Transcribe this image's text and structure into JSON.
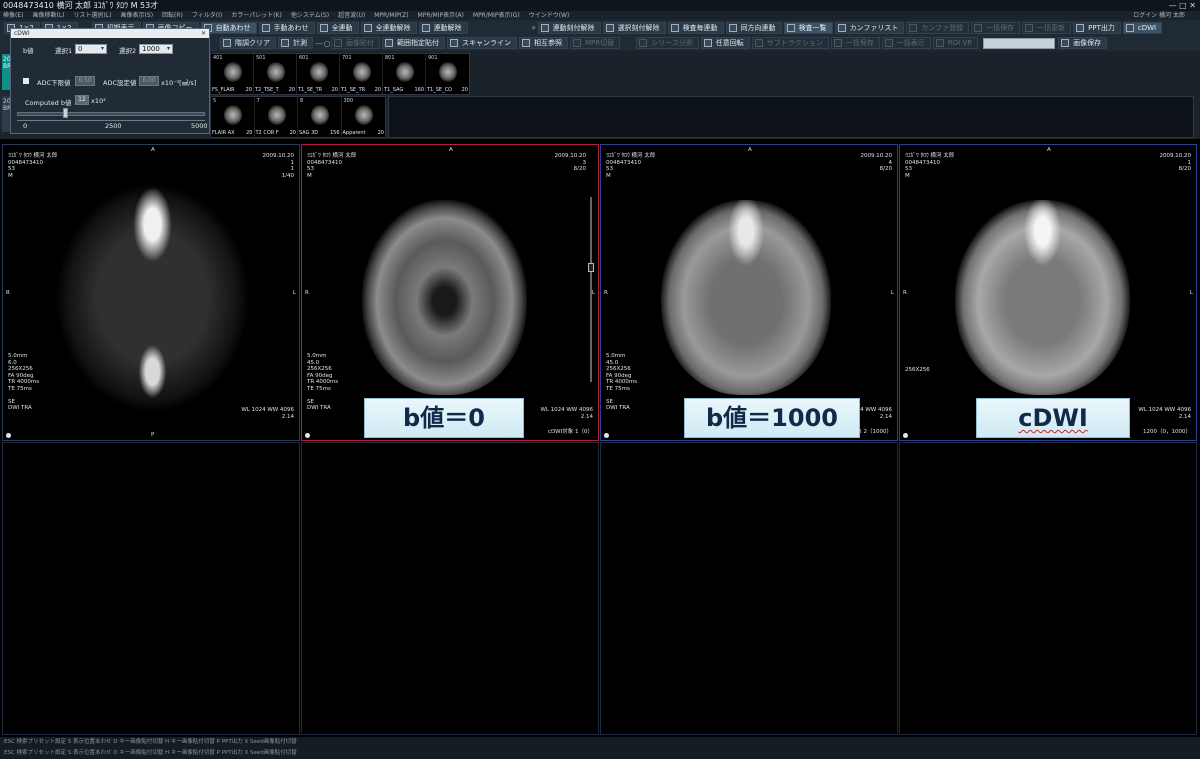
{
  "window": {
    "title": "0048473410 横河 太郎 ﾖｺｶﾞﾜ ﾀﾛｳ M 53才",
    "controls": "— □ ✕"
  },
  "menu": {
    "items": [
      "検像(E)",
      "画像移動(L)",
      "リスト選択(L)",
      "画像表示(S)",
      "回転(R)",
      "フィルタ(I)",
      "カラーパレット(K)",
      "他システム(S)",
      "超音波(U)",
      "MPR/MIP(Z)",
      "MPR/MIP表示(A)",
      "MPR/MIP表示(G)",
      "ウインドウ(W)"
    ],
    "login": "ログイン 横河 太郎"
  },
  "toolbar1": {
    "first": "1×2",
    "second": "1×2",
    "buttons": [
      "初期表示",
      "画像コピー",
      "自動あわせ",
      "手動あわせ",
      "全連動",
      "全連動解除",
      "連動解除"
    ],
    "right_buttons": [
      "連動刻付解除",
      "選択刻付解除",
      "検査毎連動",
      "同方向連動",
      "検査一覧",
      "カンファリスト",
      "カンファ登録",
      "一括保存",
      "一括更新",
      "PPT出力",
      "cDWI"
    ]
  },
  "toolbar2": {
    "buttons": [
      "階調クリア",
      "計測",
      "画像貼付",
      "範囲指定貼付",
      "スキャンライン",
      "相互参照",
      "MPR切替"
    ],
    "right_buttons": [
      "シリーズ分割",
      "任意回転",
      "サブトラクション",
      "一括保存",
      "一括表示",
      "ROI VR",
      "画像保存"
    ]
  },
  "dialog": {
    "title": "cDWI",
    "close": "✕",
    "bval_label": "b値",
    "sel1_label": "選択1",
    "sel1_value": "0",
    "sel2_label": "選択2",
    "sel2_value": "1000",
    "adc_lower_label": "ADC下限値",
    "adc_lower_value": "0.50",
    "adc_set_label": "ADC設定値",
    "adc_set_value": "0.00",
    "adc_unit": "x10⁻³[㎟/s]",
    "computed_label": "Computed b値",
    "computed_value": "12",
    "computed_unit": "x10²",
    "scale_min": "0",
    "scale_mid": "2500",
    "scale_max": "5000"
  },
  "leftpanel": {
    "btn1": "20 BR",
    "btn2": "20 BR"
  },
  "thumbnails_row1": [
    {
      "num": "401",
      "label": "FS_FLAIR",
      "count": "20"
    },
    {
      "num": "501",
      "label": "T2_TSE_T",
      "count": "20"
    },
    {
      "num": "601",
      "label": "T1_SE_TR",
      "count": "20"
    },
    {
      "num": "701",
      "label": "T1_SE_TR",
      "count": "20"
    },
    {
      "num": "801",
      "label": "T1_SAG",
      "count": "160"
    },
    {
      "num": "901",
      "label": "T1_SE_CO",
      "count": "20"
    }
  ],
  "thumbnails_row2": [
    {
      "num": "5",
      "label": "FLAIR AX",
      "count": "20"
    },
    {
      "num": "7",
      "label": "T2 COR F",
      "count": "20"
    },
    {
      "num": "8",
      "label": "SAG 3D",
      "count": "156"
    },
    {
      "num": "300",
      "label": "Apparent",
      "count": "20"
    }
  ],
  "viewports": [
    {
      "anterior": "A",
      "posterior": "P",
      "left": "L",
      "right": "R",
      "tl": "ﾖｺｶﾞﾜ ﾀﾛｳ 横河 太郎\n0048473410\n53\nM",
      "tr": "2009.10.20\n1\n1\n1/40",
      "bl": "5.0mm\n6.0\n256X256\nFA 90deg\nTR 4000ms\nTE 75ms\n\nSE\nDWI TRA",
      "br": "WL 1024 WW 4096\n2.14",
      "wl": "1024",
      "ww": "4096"
    },
    {
      "anterior": "A",
      "left": "L",
      "right": "R",
      "tl": "ﾖｺｶﾞﾜ ﾀﾛｳ 横河 太郎\n0048473410\n53\nM",
      "tr": "2009.10.20\n3\n8/20",
      "bl": "5.0mm\n45.0\n256X256\nFA 90deg\nTR 4000ms\nTE 75ms\n\nSE\nDWI TRA",
      "br": "WL 1024 WW 4096\n2.14",
      "br2": "cDWI対象 1（0）",
      "label": "b値＝0"
    },
    {
      "anterior": "A",
      "left": "L",
      "right": "R",
      "tl": "ﾖｺｶﾞﾜ ﾀﾛｳ 横河 太郎\n0048473410\n53\nM",
      "tr": "2009.10.20\n4\n8/20",
      "bl": "5.0mm\n45.0\n256X256\nFA 90deg\nTR 4000ms\nTE 75ms\n\nSE\nDWI TRA",
      "br": "WL 1024 WW 4096\n2.14",
      "br2": "象 2（1000）",
      "label": "b値＝1000"
    },
    {
      "anterior": "A",
      "left": "L",
      "right": "R",
      "tl": "ﾖｺｶﾞﾜ ﾀﾛｳ 横河 太郎\n0048473410\n53\nM",
      "tr": "2009.10.20\n1\n8/20",
      "bl": "256X256",
      "br": "WL 1024 WW 4096\n2.14",
      "br2": "1200（0，1000）",
      "label": "cDWI"
    }
  ],
  "status": {
    "line1": "ESC 検索プリセット設定  S 表示位置あわせ  D キー画像貼付切替  H キー画像貼付切替  P PPT出力  X Seed画像貼付切替",
    "line2": "ESC 検索プリセット設定  S 表示位置あわせ  D キー画像貼付切替  H キー画像貼付切替  P PPT出力  X Seed画像貼付切替"
  }
}
